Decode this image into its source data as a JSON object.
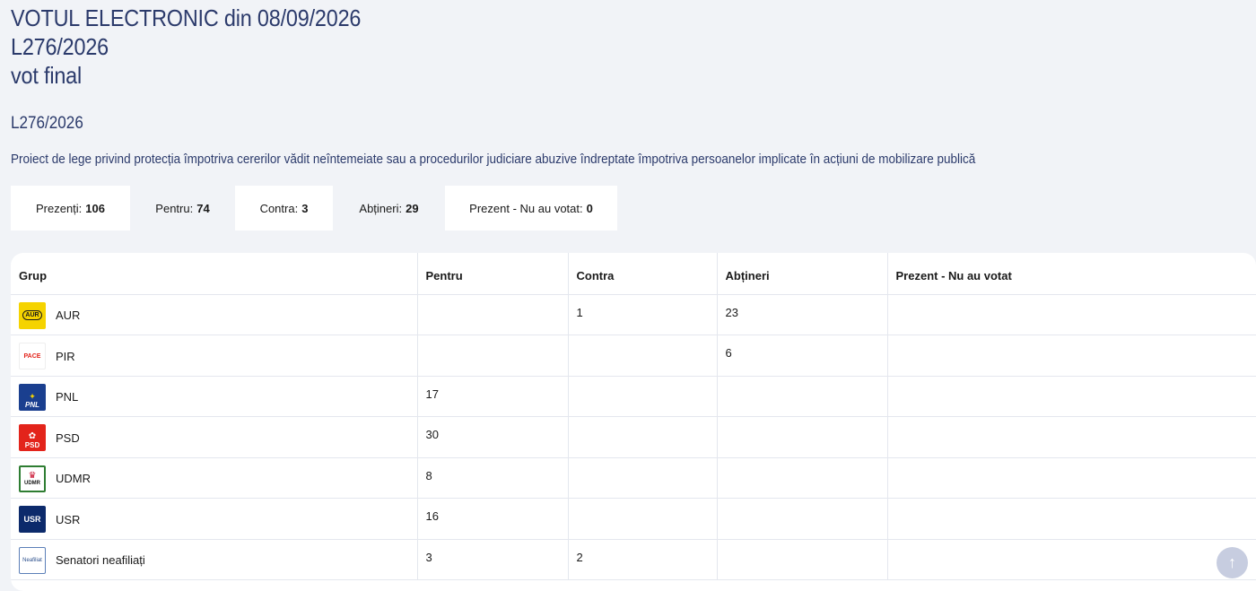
{
  "title": {
    "line1": "VOTUL ELECTRONIC din 08/09/2026",
    "line2": "L276/2026",
    "line3": "vot final"
  },
  "code": "L276/2026",
  "description": "Proiect de lege privind protecția împotriva cererilor vădit neîntemeiate sau a procedurilor judiciare abuzive îndreptate împotriva persoanelor implicate în acțiuni de mobilizare publică",
  "stats": [
    {
      "label": "Prezenți:",
      "value": "106"
    },
    {
      "label": "Pentru:",
      "value": "74"
    },
    {
      "label": "Contra:",
      "value": "3"
    },
    {
      "label": "Abțineri:",
      "value": "29"
    },
    {
      "label": "Prezent - Nu au votat:",
      "value": "0"
    }
  ],
  "table": {
    "headers": [
      "Grup",
      "Pentru",
      "Contra",
      "Abțineri",
      "Prezent - Nu au votat"
    ],
    "rows": [
      {
        "group": "AUR",
        "logo_text": "AUR",
        "pentru": "",
        "contra": "1",
        "abtineri": "23",
        "prezent": ""
      },
      {
        "group": "PIR",
        "logo_text": "PACE",
        "pentru": "",
        "contra": "",
        "abtineri": "6",
        "prezent": ""
      },
      {
        "group": "PNL",
        "logo_text": "PNL",
        "pentru": "17",
        "contra": "",
        "abtineri": "",
        "prezent": ""
      },
      {
        "group": "PSD",
        "logo_text": "PSD",
        "pentru": "30",
        "contra": "",
        "abtineri": "",
        "prezent": ""
      },
      {
        "group": "UDMR",
        "logo_text": "UDMR",
        "pentru": "8",
        "contra": "",
        "abtineri": "",
        "prezent": ""
      },
      {
        "group": "USR",
        "logo_text": "USR",
        "pentru": "16",
        "contra": "",
        "abtineri": "",
        "prezent": ""
      },
      {
        "group": "Senatori neafiliați",
        "logo_text": "Neafiliat",
        "pentru": "3",
        "contra": "2",
        "abtineri": "",
        "prezent": ""
      }
    ]
  },
  "colors": {
    "title": "#2b3a6b",
    "aur": "#f5d300",
    "pnl": "#1a3f8f",
    "psd": "#e3241b",
    "usr": "#0c2a6b",
    "udmr": "#2e7d32"
  },
  "scroll_top_icon": "arrow-up-icon"
}
